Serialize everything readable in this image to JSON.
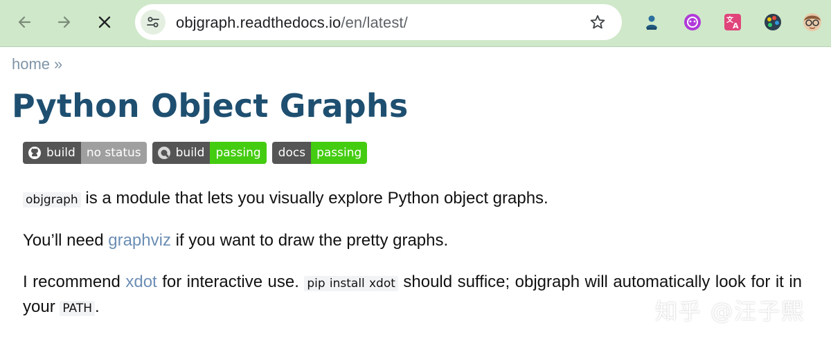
{
  "browser": {
    "url_host": "objgraph.readthedocs.io",
    "url_path": "/en/latest/",
    "back_icon": "back-arrow-icon",
    "forward_icon": "forward-arrow-icon",
    "stop_icon": "close-icon",
    "bookmark_icon": "star-icon",
    "extensions": [
      "person-extension-icon",
      "purple-ai-extension-icon",
      "translate-extension-icon",
      "palette-extension-icon",
      "avatar-extension-icon"
    ],
    "chrome_color": "#cfe8c9"
  },
  "page": {
    "breadcrumb_home": "home",
    "breadcrumb_sep": "»",
    "title": "Python Object Graphs",
    "badges": [
      {
        "label": "build",
        "value": "no status",
        "value_color": "#9f9f9f",
        "icon": "github-icon"
      },
      {
        "label": "build",
        "value": "passing",
        "value_color": "#4c1",
        "icon": "appveyor-icon"
      },
      {
        "label": "docs",
        "value": "passing",
        "value_color": "#4c1",
        "icon": ""
      }
    ],
    "p1": {
      "code": "objgraph",
      "text": " is a module that lets you visually explore Python object graphs."
    },
    "p2": {
      "before": "You’ll need ",
      "link": "graphviz",
      "after": " if you want to draw the pretty graphs."
    },
    "p3": {
      "before": "I recommend ",
      "link": "xdot",
      "mid": " for interactive use. ",
      "code": "pip install xdot",
      "after": " should suffice; objgraph will automatically look for it in your ",
      "code2": "PATH",
      "end": "."
    },
    "link_color": "#6c8eb5",
    "title_color": "#1e4f70"
  },
  "watermark": "知乎 @汪子熙"
}
